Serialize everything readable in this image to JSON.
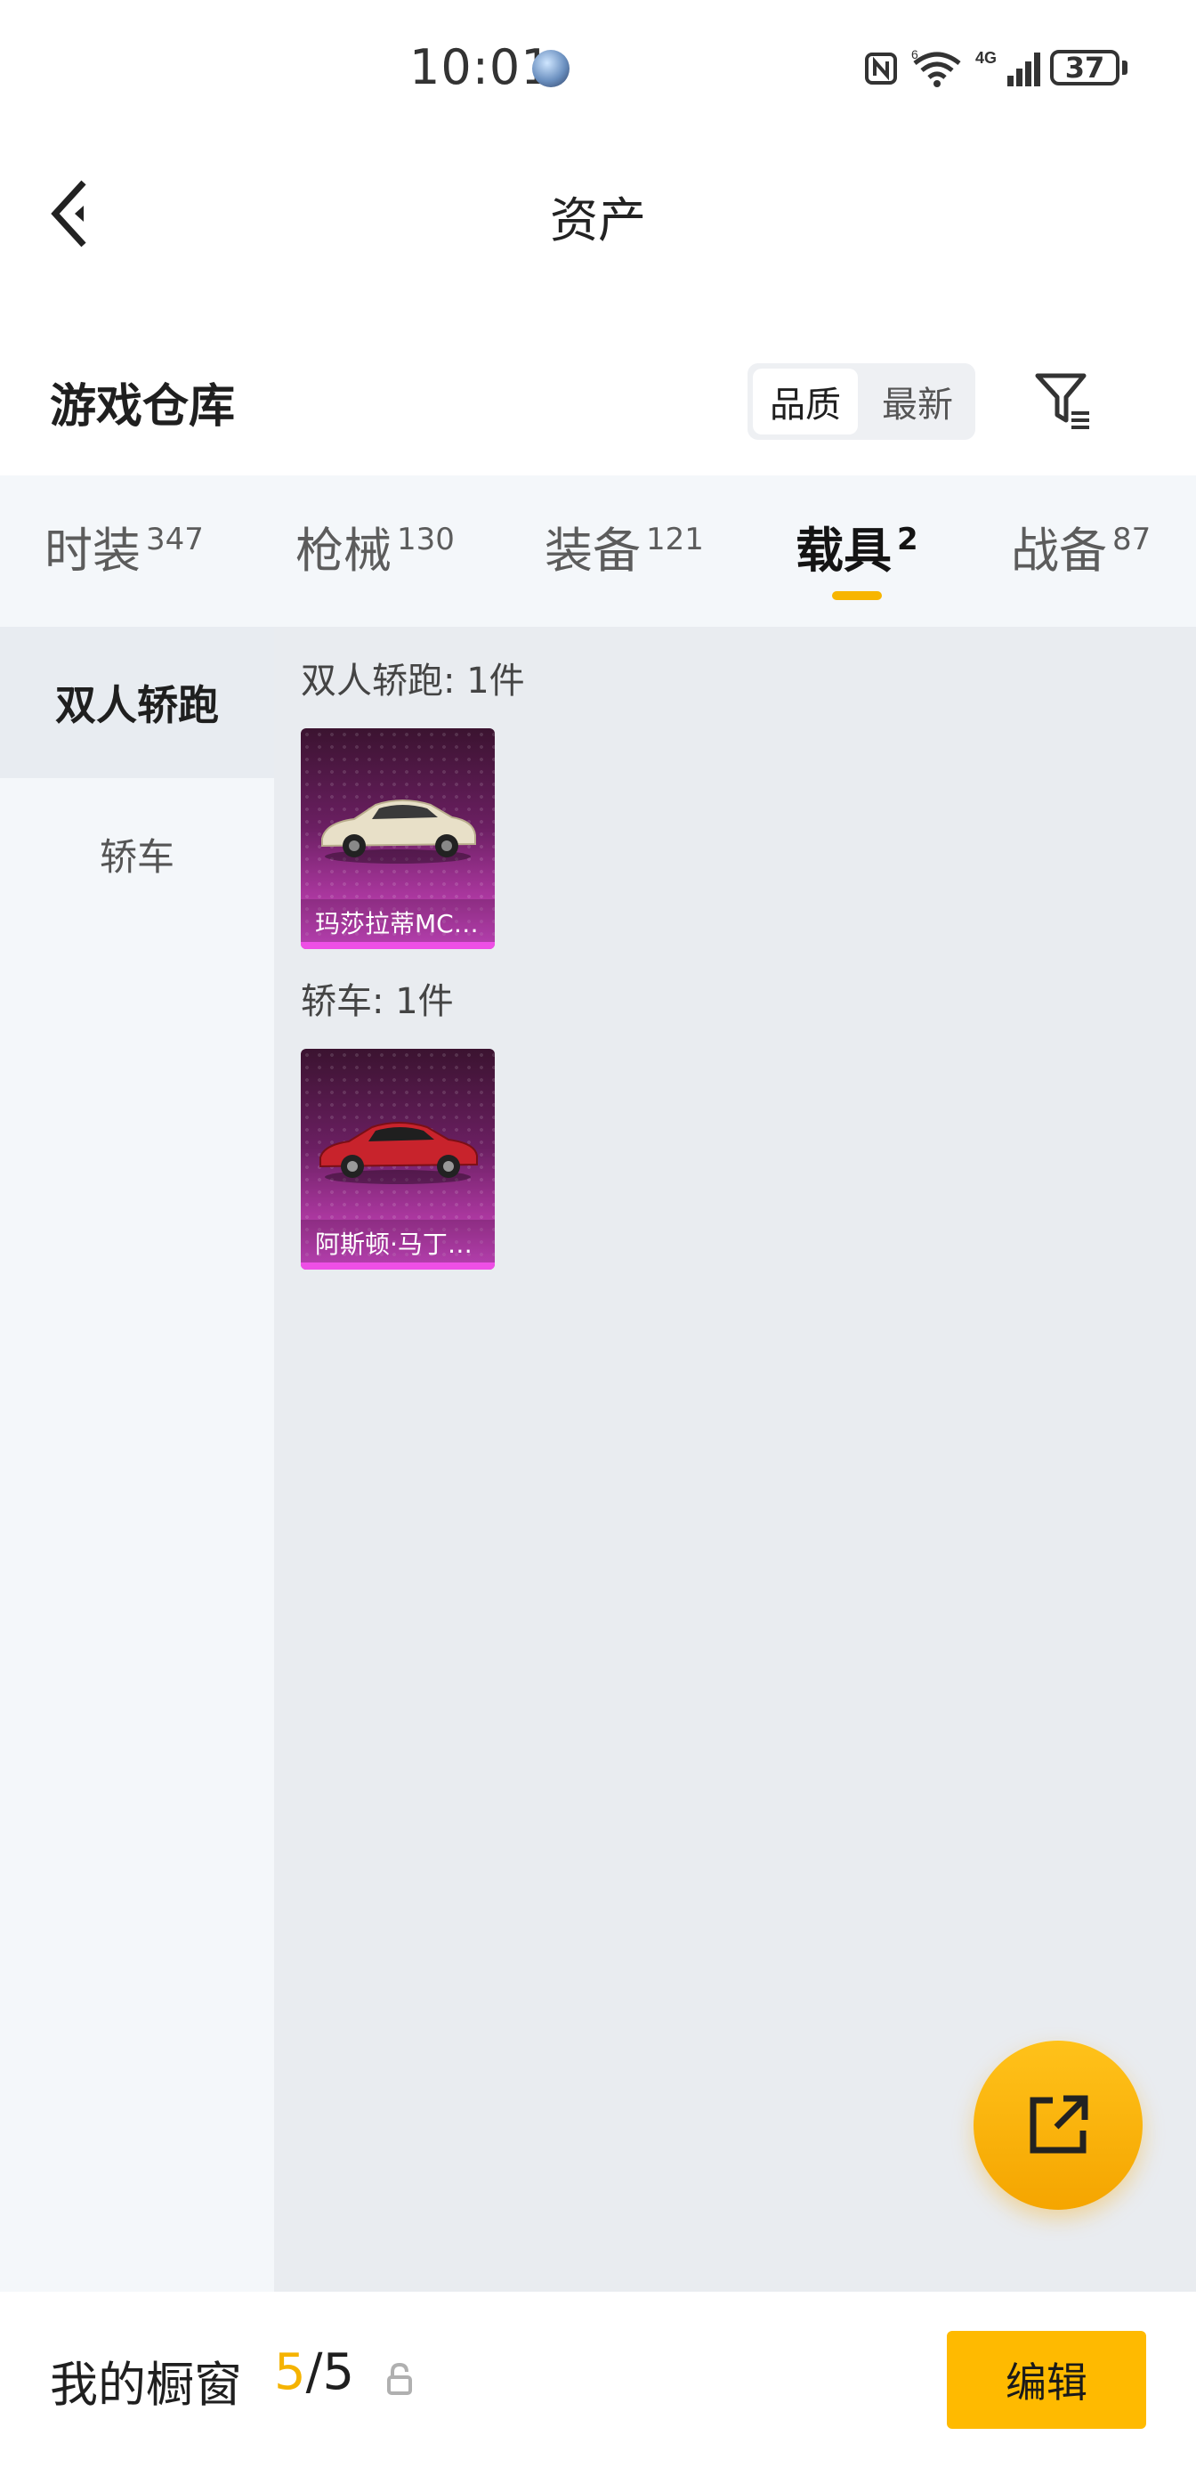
{
  "status_bar": {
    "time": "10:01",
    "battery": "37",
    "network": "4G",
    "wifi_badge": "6"
  },
  "header": {
    "title": "资产"
  },
  "toolbar": {
    "section_title": "游戏仓库",
    "sort_options": [
      "品质",
      "最新"
    ],
    "active_sort": "品质"
  },
  "tabs": [
    {
      "label": "时装",
      "count": "347"
    },
    {
      "label": "枪械",
      "count": "130"
    },
    {
      "label": "装备",
      "count": "121"
    },
    {
      "label": "载具",
      "count": "2"
    },
    {
      "label": "战备",
      "count": "87"
    }
  ],
  "active_tab": "载具",
  "sidebar": {
    "items": [
      {
        "label": "双人轿跑"
      },
      {
        "label": "轿车"
      }
    ]
  },
  "content": {
    "groups": [
      {
        "label": "双人轿跑: 1件",
        "items": [
          {
            "name": "玛莎拉蒂MC…",
            "color": "#e8e0c8"
          }
        ]
      },
      {
        "label": "轿车: 1件",
        "items": [
          {
            "name": "阿斯顿·马丁…",
            "color": "#c8232c"
          }
        ]
      }
    ]
  },
  "bottom_bar": {
    "showcase_label": "我的橱窗",
    "showcase_current": "5",
    "showcase_sep": "/",
    "showcase_total": "5",
    "edit_label": "编辑"
  },
  "colors": {
    "accent": "#f7b500",
    "card_rarity": "#e04fd8"
  }
}
